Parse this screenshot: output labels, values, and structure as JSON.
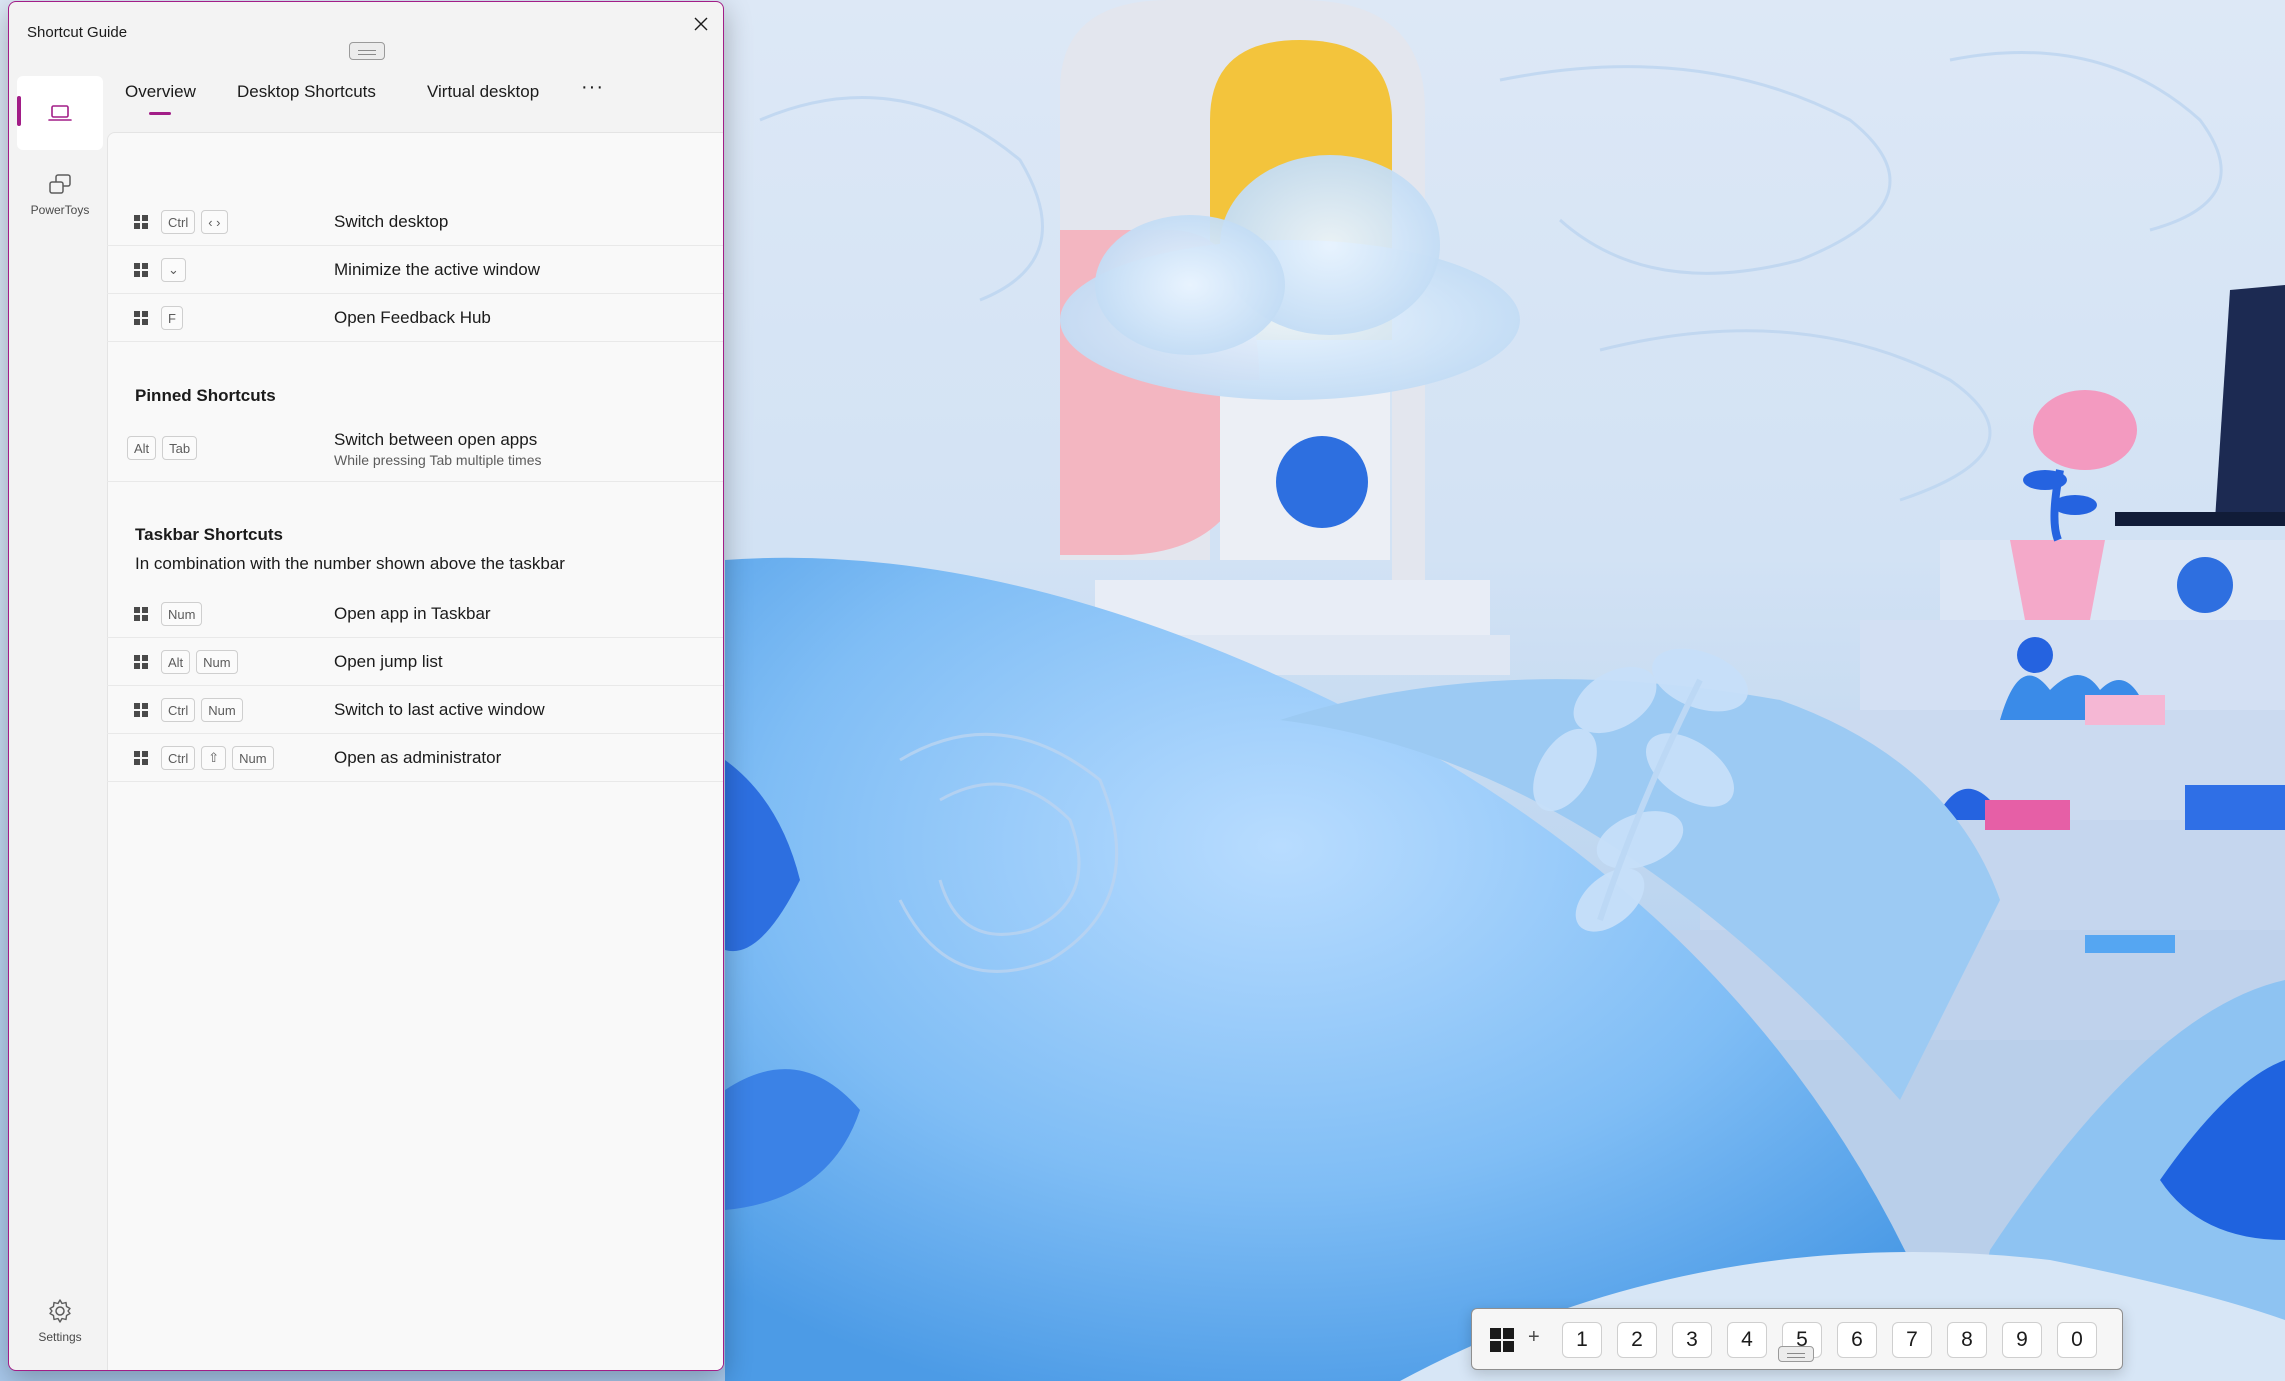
{
  "window": {
    "title": "Shortcut Guide",
    "accent_color": "#a21d87"
  },
  "nav": {
    "items": [
      {
        "label": "",
        "icon": "laptop-icon",
        "selected": true
      },
      {
        "label": "PowerToys",
        "icon": "powertoys-windows-icon",
        "selected": false
      }
    ],
    "settings_label": "Settings",
    "settings_icon": "gear-icon"
  },
  "tabs": [
    {
      "label": "Overview",
      "selected": true
    },
    {
      "label": "Desktop Shortcuts",
      "selected": false
    },
    {
      "label": "Virtual desktop",
      "selected": false
    }
  ],
  "more_label": "···",
  "shortcuts": [
    {
      "keys": [
        "Win",
        "Ctrl",
        "‹ ›"
      ],
      "description": "Switch desktop"
    },
    {
      "keys": [
        "Win",
        "⌄"
      ],
      "description": "Minimize the active window"
    },
    {
      "keys": [
        "Win",
        "F"
      ],
      "description": "Open Feedback Hub"
    }
  ],
  "pinned": {
    "title": "Pinned Shortcuts",
    "items": [
      {
        "keys": [
          "Alt",
          "Tab"
        ],
        "description": "Switch between open apps",
        "subdescription": "While pressing Tab multiple times"
      }
    ]
  },
  "taskbar": {
    "title": "Taskbar Shortcuts",
    "subtitle": "In combination with the number shown above the taskbar",
    "items": [
      {
        "keys": [
          "Win",
          "Num"
        ],
        "description": "Open app in Taskbar"
      },
      {
        "keys": [
          "Win",
          "Alt",
          "Num"
        ],
        "description": "Open jump list"
      },
      {
        "keys": [
          "Win",
          "Ctrl",
          "Num"
        ],
        "description": "Switch to last active window"
      },
      {
        "keys": [
          "Win",
          "Ctrl",
          "⇧",
          "Num"
        ],
        "description": "Open as administrator"
      }
    ]
  },
  "number_overlay": {
    "plus": "+",
    "numbers": [
      "1",
      "2",
      "3",
      "4",
      "5",
      "6",
      "7",
      "8",
      "9",
      "0"
    ]
  }
}
